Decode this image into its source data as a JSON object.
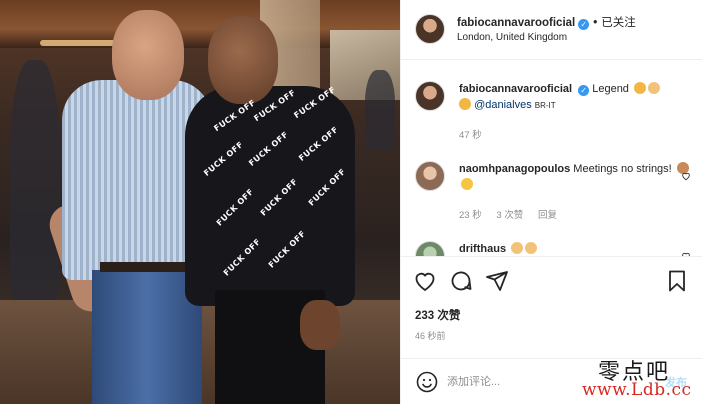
{
  "post": {
    "username": "fabiocannavarooficial",
    "verified": true,
    "follow_separator": "•",
    "follow_label": "已关注",
    "location": "London, United Kingdom"
  },
  "photo": {
    "shirt_text": "FUCK OFF"
  },
  "caption": {
    "username": "fabiocannavarooficial",
    "text": "Legend",
    "emojis": [
      "praying-hands",
      "clapping-hands"
    ],
    "mention_prefix_emoji": "flexed-biceps",
    "mention": "@danialves",
    "translation_tag": "BR-IT",
    "time": "47 秒"
  },
  "comments": [
    {
      "username": "naomhpanagopoulos",
      "text": "Meetings no strings!",
      "emojis": [
        "person-tipping-hand",
        "smiling-face"
      ],
      "time": "23 秒",
      "likes": "3 次赞",
      "reply_label": "回复"
    },
    {
      "username": "drifthaus",
      "text": "",
      "emojis": [
        "clapping-hands",
        "clapping-hands"
      ]
    }
  ],
  "actions": {
    "like_count": "233 次赞",
    "time": "46 秒前"
  },
  "composer": {
    "placeholder": "添加评论...",
    "post_label": "发布"
  },
  "watermark": {
    "cn": "零点吧",
    "en": "www.Ldb.cc"
  },
  "colors": {
    "verified": "#3897f0",
    "mention": "#00376b",
    "muted": "#8e8e8e",
    "post_disabled": "#b2dffc",
    "watermark_red": "#d6281f"
  }
}
